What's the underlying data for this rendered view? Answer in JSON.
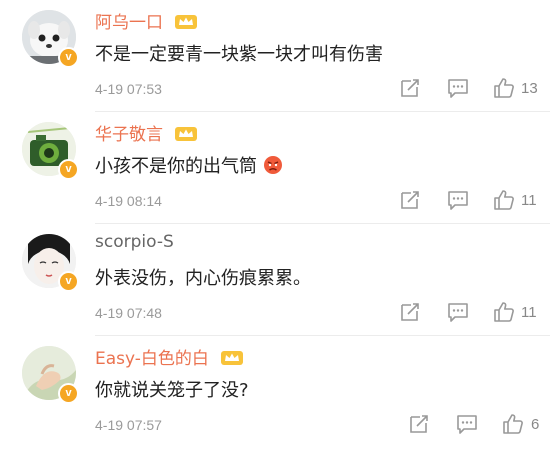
{
  "comments": [
    {
      "name": "阿乌一口",
      "text": "不是一定要青一块紫一块才叫有伤害",
      "time": "4-19 07:53",
      "likes": "13"
    },
    {
      "name": "华子敬言",
      "text": "小孩不是你的出气筒",
      "time": "4-19 08:14",
      "likes": "11"
    },
    {
      "name": "scorpio-S",
      "text": "外表没伤，内心伤痕累累。",
      "time": "4-19 07:48",
      "likes": "11"
    },
    {
      "name": "Easy-白色的白",
      "text": "你就说关笼子了没?",
      "time": "4-19 07:57",
      "likes": "6"
    }
  ],
  "icons": {
    "verified": "v-verified-icon",
    "member": "crown-member-icon",
    "repost": "repost-icon",
    "comment": "comment-icon",
    "like": "thumbs-up-icon",
    "emoji": "angry-face-emoji"
  },
  "colors": {
    "name": "#eb7350",
    "text": "#222222",
    "meta": "#9a9a9a",
    "badge": "#f5a623"
  }
}
